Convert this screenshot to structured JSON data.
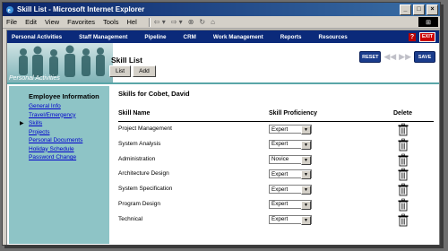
{
  "window": {
    "title": "Skill List - Microsoft Internet Explorer"
  },
  "menu": [
    "File",
    "Edit",
    "View",
    "Favorites",
    "Tools",
    "Hel"
  ],
  "nav": [
    "Personal Activities",
    "Staff Management",
    "Pipeline",
    "CRM",
    "Work Management",
    "Reports",
    "Resources"
  ],
  "header": {
    "section": "Personal Activities",
    "title": "Skill List",
    "list": "List",
    "add": "Add",
    "reset": "RESET",
    "save": "SAVE",
    "exit": "EXIT"
  },
  "sidebar": {
    "heading": "Employee Information",
    "links": [
      "General Info",
      "Travel/Emergency",
      "Skills",
      "Projects",
      "Personal Documents",
      "Holiday Schedule",
      "Password Change"
    ],
    "current": 2
  },
  "content": {
    "heading": "Skills for Cobet, David",
    "col_name": "Skill Name",
    "col_prof": "Skill Proficiency",
    "col_del": "Delete"
  },
  "skills": [
    {
      "name": "Project Management",
      "level": "Expert"
    },
    {
      "name": "System Analysis",
      "level": "Expert"
    },
    {
      "name": "Administration",
      "level": "Novice"
    },
    {
      "name": "Architecture Design",
      "level": "Expert"
    },
    {
      "name": "System Specification",
      "level": "Expert"
    },
    {
      "name": "Program Design",
      "level": "Expert"
    },
    {
      "name": "Technical",
      "level": "Expert"
    }
  ],
  "colors": {
    "nav": "#0b2a7a",
    "teal": "#8ec4c6",
    "title": "#0a246a"
  }
}
